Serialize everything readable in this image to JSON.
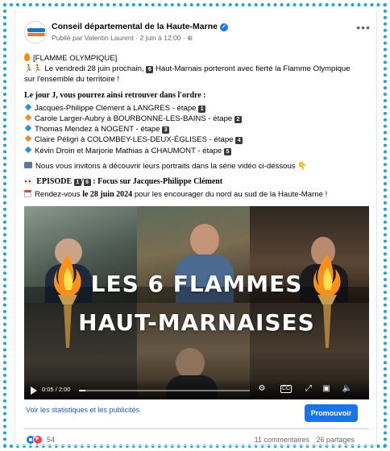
{
  "post": {
    "page_name": "Conseil départemental de la Haute-Marne",
    "meta": "Publié par Valentin Laurent · 2 juin à 12:00 · ",
    "lines": {
      "l1": "[FLAMME OLYMPIQUE]",
      "l2a": "Le vendredi 28 juin prochain,",
      "l2b": "Haut-Marnais porteront avec fierté la Flamme Olympique",
      "l3": "sur l'ensemble du territoire !",
      "l4": "Le jour J, vous pourrez ainsi retrouver dans l'ordre :",
      "r1": "Jacques-Philippe Clément à LANGRES - étape",
      "r2": "Carole Larger-Aubry à BOURBONNE-LES-BAINS - étape",
      "r3": "Thomas Mendez à NOGENT - étape",
      "r4": "Claire Péligri à COLOMBEY-LES-DEUX-ÉGLISES - étape",
      "r5": "Kévin Droin et Marjorie Mathias à CHAUMONT - étape",
      "l5": "Nous vous invitons à découvrir leurs portraits dans la série vidéo ci-dessous",
      "l6a": "EPISODE",
      "l6b": ": Focus sur Jacques-Philippe Clément",
      "l7a": "Rendez-vous",
      "l7b": "le 28 juin 2024",
      "l7c": "pour les encourager du nord au sud de la Haute-Marne !"
    },
    "badges": {
      "n6": "6",
      "n1": "1",
      "n2": "2",
      "n3": "3",
      "n4": "4",
      "n5": "5",
      "ep1": "1",
      "ep6": "6"
    }
  },
  "video": {
    "title_line1": "LES 6  FLAMMES",
    "title_line2": "HAUT-MARNAISES",
    "time": "0:05 / 2:00",
    "progress": 0.04
  },
  "footer": {
    "stats_link": "Voir les statistiques et les publicités",
    "promote_label": "Promouvoir",
    "reaction_count": "54",
    "comments": "11 commentaires",
    "shares": "26 partages"
  },
  "colors": {
    "accent": "#1b74e4",
    "frame": "#1aa3d9",
    "link": "#1b5fb3"
  },
  "icons": [
    "verified-icon",
    "globe-icon",
    "more-options-icon",
    "play-icon",
    "settings-icon",
    "captions-icon",
    "fullscreen-icon",
    "pip-icon",
    "volume-icon",
    "like-reaction-icon",
    "love-reaction-icon"
  ]
}
